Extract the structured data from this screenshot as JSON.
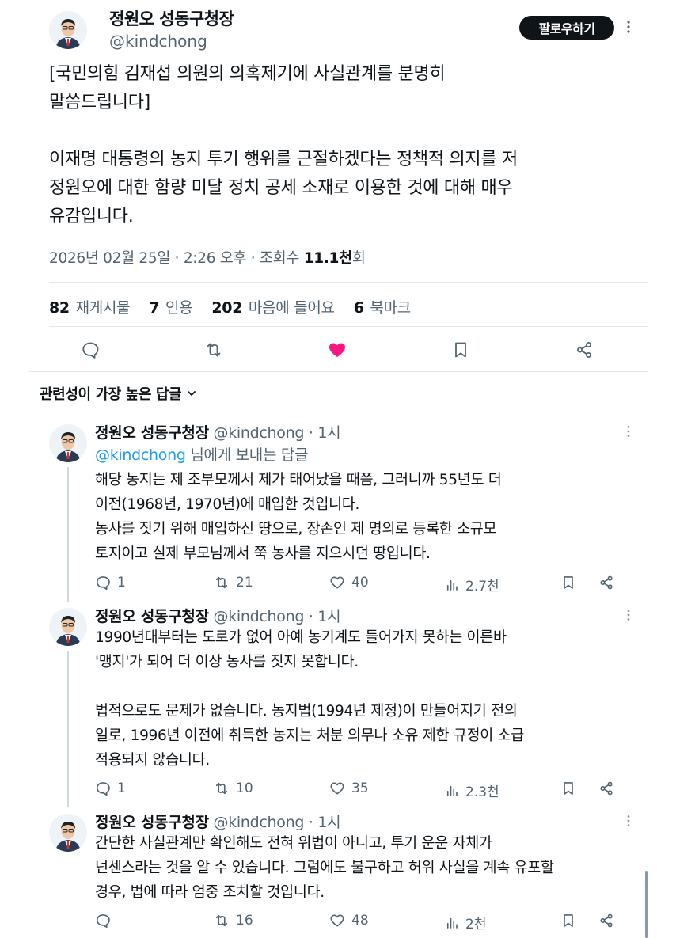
{
  "main_tweet": {
    "author_name": "정원오 성동구청장",
    "handle": "@kindchong",
    "follow_label": "팔로우하기",
    "body": "[국민의힘 김재섭 의원의 의혹제기에 사실관계를 분명히\n말씀드립니다]\n\n이재명 대통령의 농지 투기 행위를 근절하겠다는 정책적 의지를 저\n정원오에 대한 함량 미달 정치 공세 소재로 이용한 것에 대해 매우\n유감입니다.",
    "timestamp": "2026년 02월 25일 · 2:26 오후 · 조회수",
    "views": "11.1천",
    "views_suffix": "회",
    "stats": {
      "reposts_count": "82",
      "reposts_label": "재게시물",
      "quotes_count": "7",
      "quotes_label": "인용",
      "likes_count": "202",
      "likes_label": "마음에 들어요",
      "bookmarks_count": "6",
      "bookmarks_label": "북마크"
    }
  },
  "sort_label": "관련성이 가장 높은 답글",
  "replies": [
    {
      "author_name": "정원오 성동구청장",
      "handle_time": "@kindchong · 1시",
      "reply_to_mention": "@kindchong",
      "reply_to_suffix": " 님에게 보내는 답글",
      "body": "해당 농지는 제 조부모께서 제가 태어났을 때쯤, 그러니까 55년도 더\n이전(1968년, 1970년)에 매입한 것입니다.\n농사를 짓기 위해 매입하신 땅으로, 장손인 제 명의로 등록한 소규모\n토지이고 실제 부모님께서 쭉 농사를 지으시던 땅입니다.",
      "replies": "1",
      "reposts": "21",
      "likes": "40",
      "views": "2.7천"
    },
    {
      "author_name": "정원오 성동구청장",
      "handle_time": "@kindchong · 1시",
      "body": "1990년대부터는 도로가 없어 아예 농기계도 들어가지 못하는 이른바\n'맹지'가 되어 더 이상 농사를 짓지 못합니다.\n\n법적으로도 문제가 없습니다. 농지법(1994년 제정)이 만들어지기 전의\n일로, 1996년 이전에 취득한 농지는 처분 의무나 소유 제한 규정이 소급\n적용되지 않습니다.",
      "replies": "1",
      "reposts": "10",
      "likes": "35",
      "views": "2.3천"
    },
    {
      "author_name": "정원오 성동구청장",
      "handle_time": "@kindchong · 1시",
      "body": "간단한 사실관계만 확인해도 전혀 위법이 아니고, 투기 운운 자체가\n넌센스라는 것을 알 수 있습니다. 그럼에도 불구하고 허위 사실을 계속 유포할\n경우, 법에 따라 엄중 조치할 것입니다.",
      "replies": "",
      "reposts": "16",
      "likes": "48",
      "views": "2천"
    }
  ],
  "colors": {
    "accent": "#1d9bf0",
    "like_active": "#f91880",
    "text": "#0f1419",
    "muted": "#536471"
  }
}
